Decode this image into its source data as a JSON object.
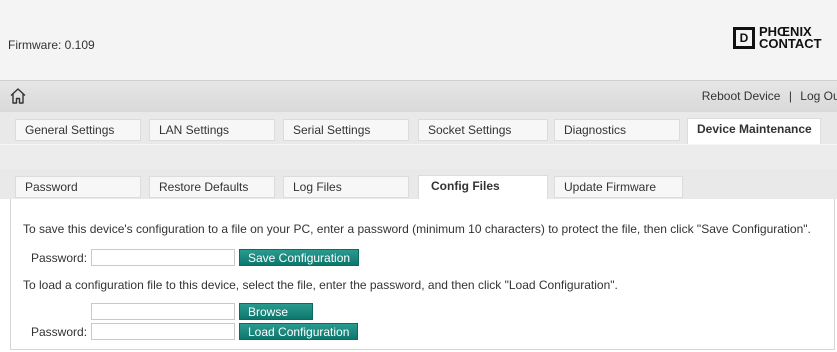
{
  "header": {
    "firmware_label": "Firmware: 0.109",
    "logo_line1": "PHŒNIX",
    "logo_line2": "CONTACT"
  },
  "nav": {
    "home_icon": "home-icon",
    "reboot": "Reboot Device",
    "separator": "|",
    "logout": "Log Out"
  },
  "main_tabs": [
    {
      "label": "General Settings"
    },
    {
      "label": "LAN Settings"
    },
    {
      "label": "Serial Settings"
    },
    {
      "label": "Socket Settings"
    },
    {
      "label": "Diagnostics"
    },
    {
      "label": "Device Maintenance",
      "active": true
    }
  ],
  "sub_tabs": [
    {
      "label": "Password"
    },
    {
      "label": "Restore Defaults"
    },
    {
      "label": "Log Files"
    },
    {
      "label": "Config Files",
      "active": true
    },
    {
      "label": "Update Firmware"
    }
  ],
  "save_section": {
    "description": "To save this device's configuration to a file on your PC, enter a password (minimum 10 characters) to protect the file, then click \"Save Configuration\".",
    "password_label": "Password:",
    "password_value": "",
    "button": "Save Configuration"
  },
  "load_section": {
    "description": "To load a configuration file to this device, select the file, enter the password, and then click \"Load Configuration\".",
    "file_value": "",
    "browse_button": "Browse",
    "password_label": "Password:",
    "password_value": "",
    "button": "Load Configuration"
  },
  "colors": {
    "accent_button": "#0e776d",
    "header_bg": "#f4f4f4",
    "nav_bg": "#dddddd"
  }
}
